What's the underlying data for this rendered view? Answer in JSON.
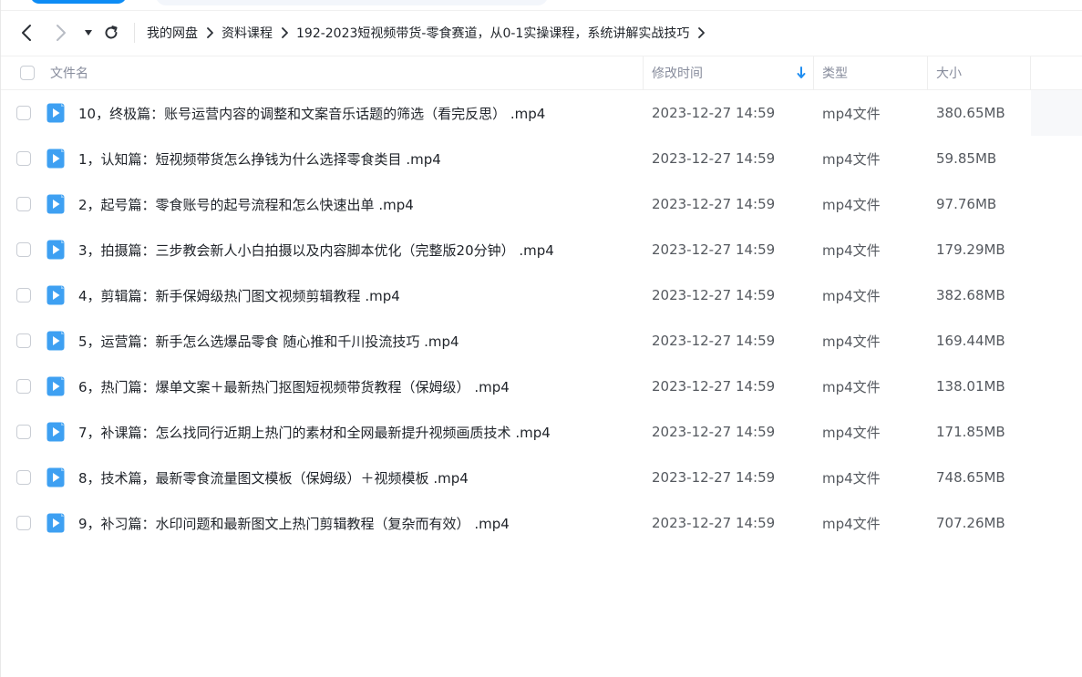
{
  "breadcrumb": [
    {
      "label": "我的网盘"
    },
    {
      "label": "资料课程"
    },
    {
      "label": "192-2023短视频带货-零食赛道，从0-1实操课程，系统讲解实战技巧"
    }
  ],
  "nav": {
    "back_icon": "chevron-left-icon",
    "forward_icon": "chevron-right-icon",
    "dropdown_icon": "caret-down-icon",
    "refresh_icon": "refresh-icon"
  },
  "table": {
    "headers": {
      "name": "文件名",
      "modified": "修改时间",
      "type": "类型",
      "size": "大小"
    },
    "sort": {
      "column": "modified",
      "direction": "descending",
      "icon": "arrow-down-icon"
    },
    "rows": [
      {
        "name": "10，终极篇：账号运营内容的调整和文案音乐话题的筛选（看完反思） .mp4",
        "modified": "2023-12-27 14:59",
        "type": "mp4文件",
        "size": "380.65MB"
      },
      {
        "name": "1，认知篇：短视频带货怎么挣钱为什么选择零食类目 .mp4",
        "modified": "2023-12-27 14:59",
        "type": "mp4文件",
        "size": "59.85MB"
      },
      {
        "name": "2，起号篇：零食账号的起号流程和怎么快速出单 .mp4",
        "modified": "2023-12-27 14:59",
        "type": "mp4文件",
        "size": "97.76MB"
      },
      {
        "name": "3，拍摄篇：三步教会新人小白拍摄以及内容脚本优化（完整版20分钟） .mp4",
        "modified": "2023-12-27 14:59",
        "type": "mp4文件",
        "size": "179.29MB"
      },
      {
        "name": "4，剪辑篇：新手保姆级热门图文视频剪辑教程 .mp4",
        "modified": "2023-12-27 14:59",
        "type": "mp4文件",
        "size": "382.68MB"
      },
      {
        "name": "5，运营篇：新手怎么选爆品零食 随心推和千川投流技巧 .mp4",
        "modified": "2023-12-27 14:59",
        "type": "mp4文件",
        "size": "169.44MB"
      },
      {
        "name": "6，热门篇：爆单文案＋最新热门抠图短视频带货教程（保姆级） .mp4",
        "modified": "2023-12-27 14:59",
        "type": "mp4文件",
        "size": "138.01MB"
      },
      {
        "name": "7，补课篇：怎么找同行近期上热门的素材和全网最新提升视频画质技术 .mp4",
        "modified": "2023-12-27 14:59",
        "type": "mp4文件",
        "size": "171.85MB"
      },
      {
        "name": "8，技术篇，最新零食流量图文模板（保姆级）＋视频模板 .mp4",
        "modified": "2023-12-27 14:59",
        "type": "mp4文件",
        "size": "748.65MB"
      },
      {
        "name": "9，补习篇：水印问题和最新图文上热门剪辑教程（复杂而有效） .mp4",
        "modified": "2023-12-27 14:59",
        "type": "mp4文件",
        "size": "707.26MB"
      }
    ]
  },
  "colors": {
    "accent": "#0d8cf5",
    "video_icon": "#3ea0f2",
    "header_text": "#878c9c",
    "row_text": "#1f2329",
    "meta_text": "#55595f"
  },
  "row_icon": "video-file-icon"
}
